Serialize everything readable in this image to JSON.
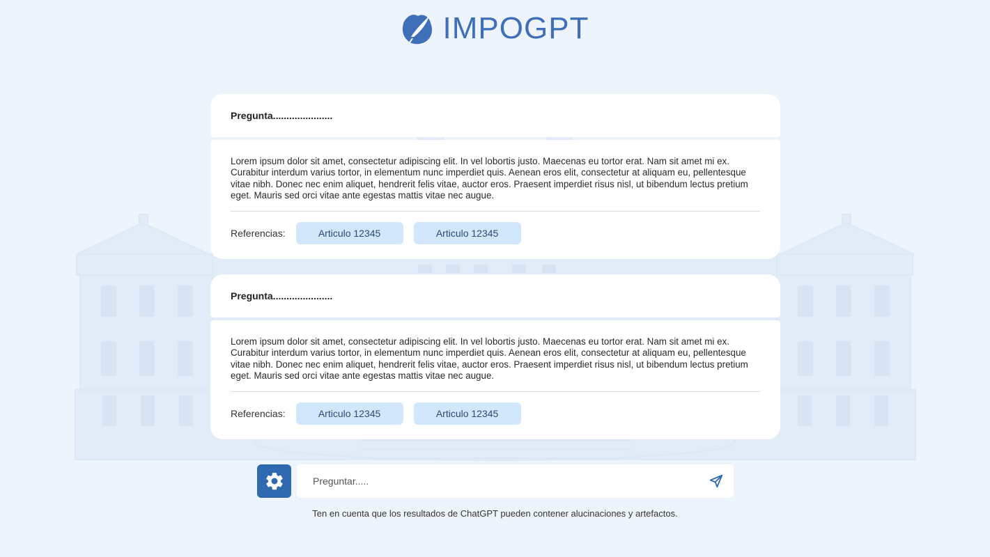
{
  "header": {
    "brand": "IMPOGPT",
    "logo_icon": "quill-feather-icon"
  },
  "conversation": [
    {
      "question": "Pregunta......................",
      "answer": "Lorem ipsum dolor sit amet, consectetur adipiscing elit. In vel lobortis justo. Maecenas eu tortor erat. Nam sit amet mi ex. Curabitur interdum varius tortor, in elementum nunc imperdiet quis. Aenean eros elit, consectetur at aliquam eu, pellentesque vitae nibh. Donec nec enim aliquet, hendrerit felis vitae, auctor eros. Praesent imperdiet risus nisl, ut bibendum lectus pretium eget. Mauris sed orci vitae ante egestas mattis vitae nec augue.",
      "references_label": "Referencias:",
      "references": [
        "Articulo 12345",
        "Articulo 12345"
      ]
    },
    {
      "question": "Pregunta......................",
      "answer": "Lorem ipsum dolor sit amet, consectetur adipiscing elit. In vel lobortis justo. Maecenas eu tortor erat. Nam sit amet mi ex. Curabitur interdum varius tortor, in elementum nunc imperdiet quis. Aenean eros elit, consectetur at aliquam eu, pellentesque vitae nibh. Donec nec enim aliquet, hendrerit felis vitae, auctor eros. Praesent imperdiet risus nisl, ut bibendum lectus pretium eget. Mauris sed orci vitae ante egestas mattis vitae nec augue.",
      "references_label": "Referencias:",
      "references": [
        "Articulo 12345",
        "Articulo 12345"
      ]
    }
  ],
  "input": {
    "placeholder": "Preguntar.....",
    "value": ""
  },
  "icons": {
    "settings": "gear-icon",
    "send": "send-icon"
  },
  "footer": {
    "disclaimer": "Ten en cuenta que los resultados de ChatGPT pueden contener alucinaciones y artefactos."
  },
  "colors": {
    "accent": "#2f6ab1",
    "brand": "#3f6fb8",
    "background": "#eef4fc",
    "chip": "#d3e7fb"
  }
}
